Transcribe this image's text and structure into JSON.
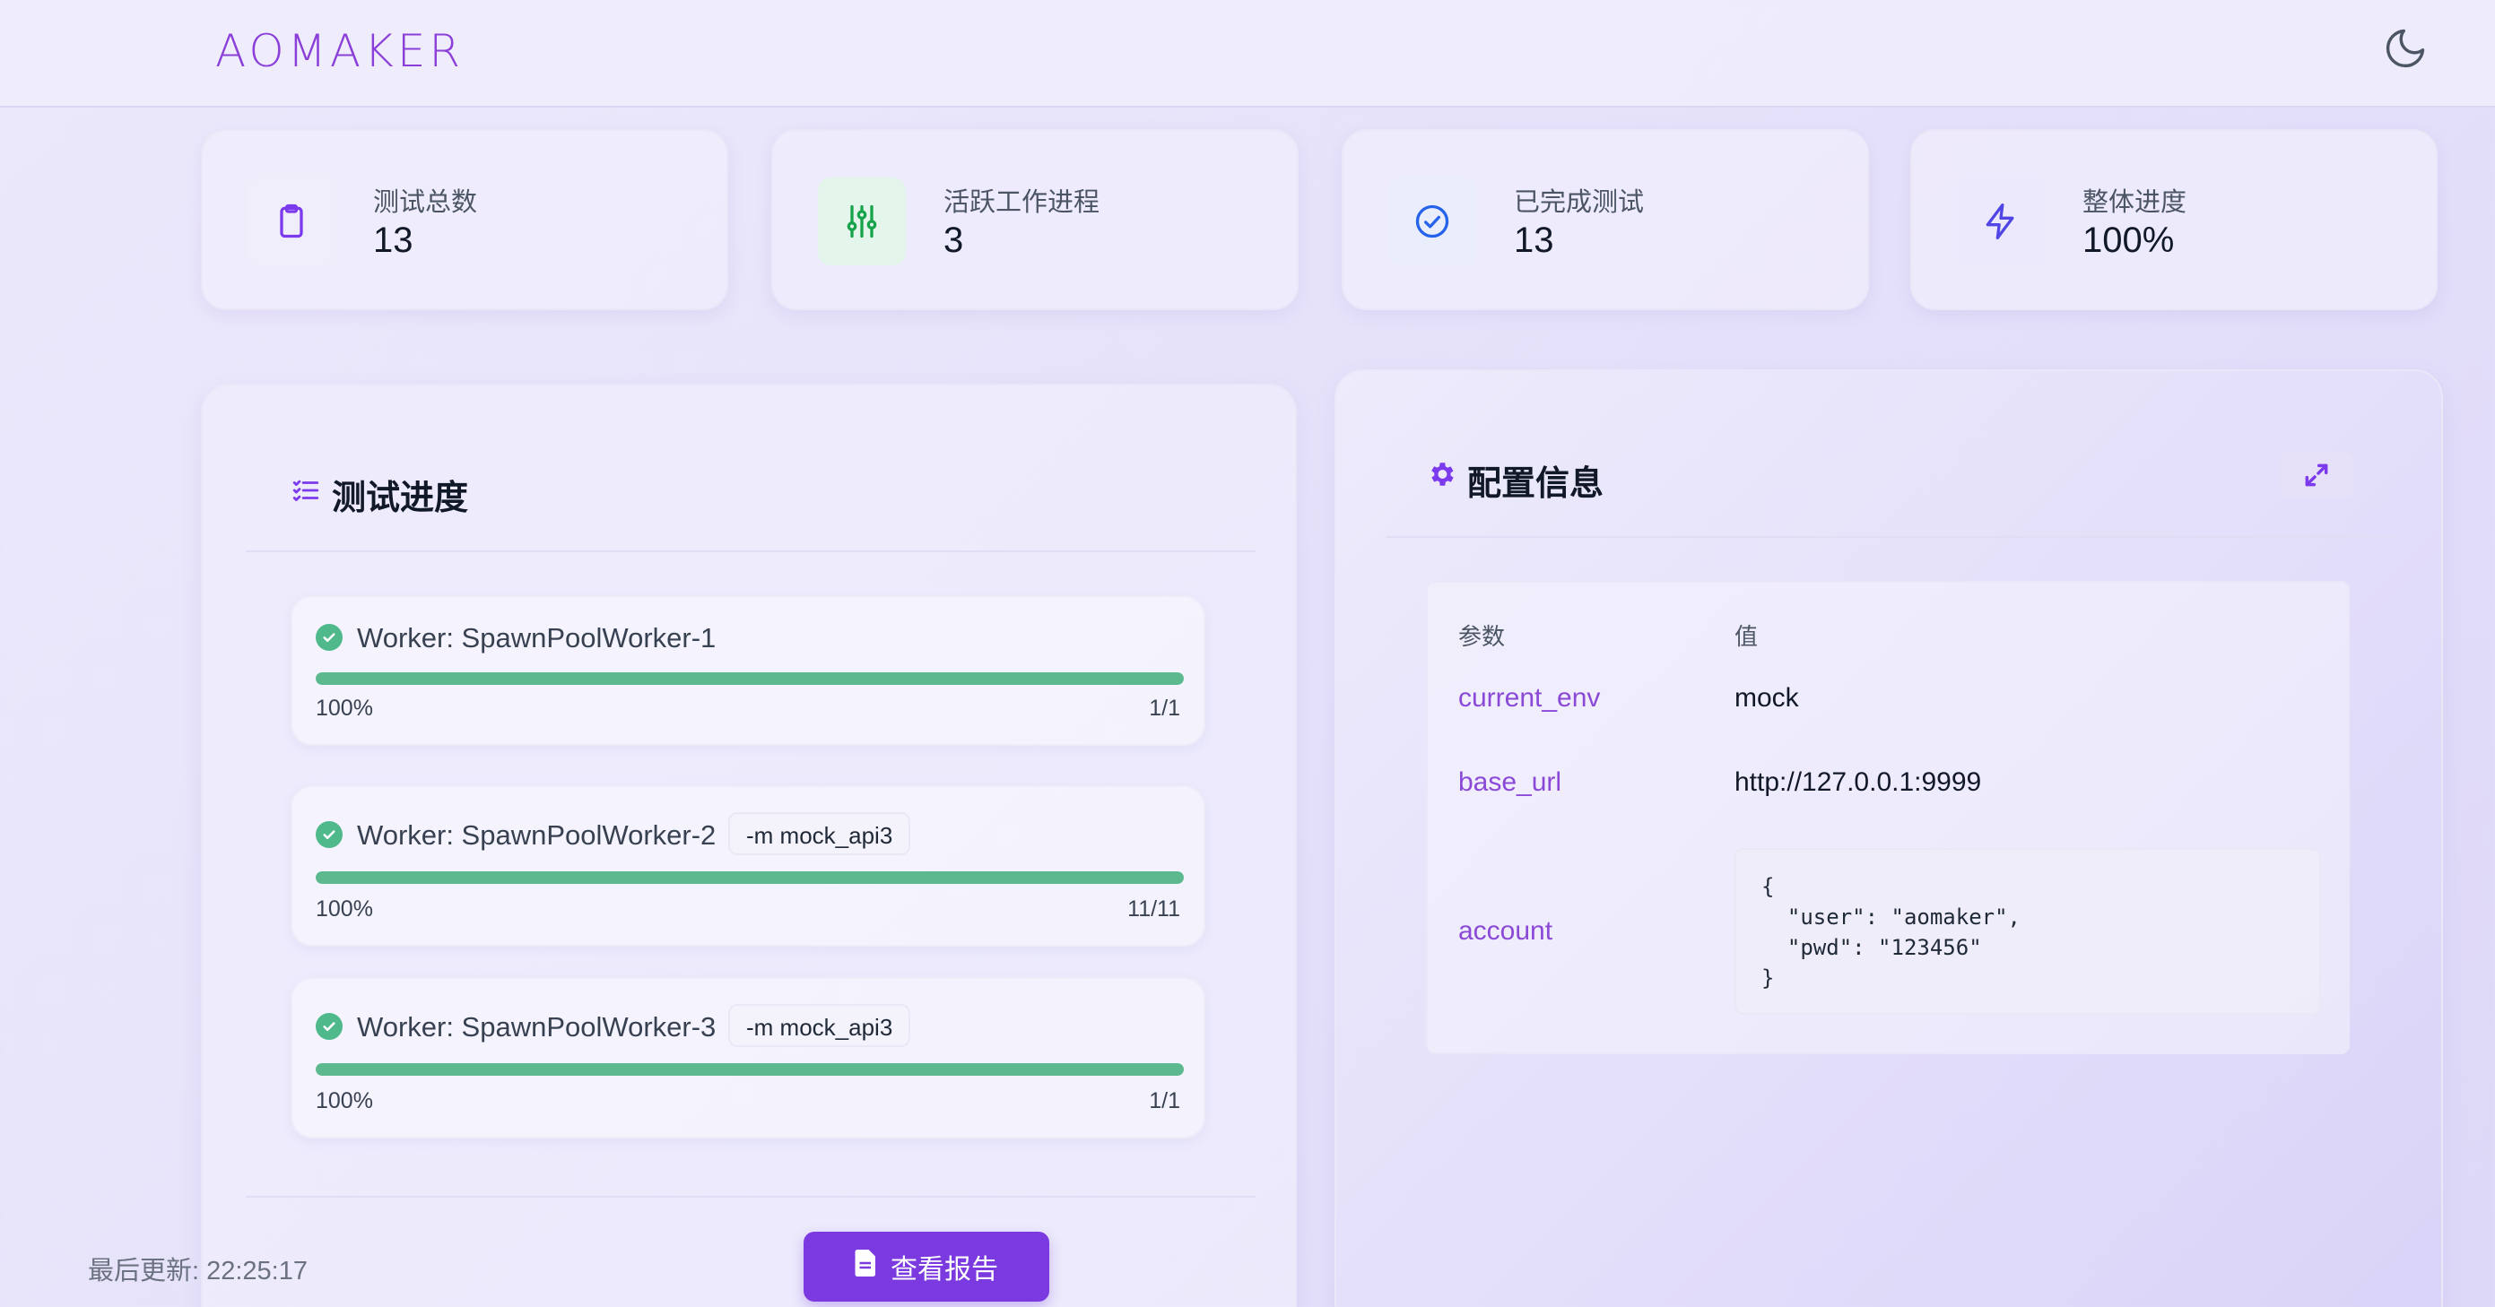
{
  "header": {
    "logo_text": "AOMAKER",
    "theme_toggle_icon": "moon-icon"
  },
  "stats": [
    {
      "label": "测试总数",
      "value": "13",
      "icon": "clipboard-icon",
      "color": "#7c3aed"
    },
    {
      "label": "活跃工作进程",
      "value": "3",
      "icon": "sliders-icon",
      "color": "#16a34a"
    },
    {
      "label": "已完成测试",
      "value": "13",
      "icon": "check-circle-icon",
      "color": "#2563eb"
    },
    {
      "label": "整体进度",
      "value": "100%",
      "icon": "lightning-icon",
      "color": "#4f46e5"
    }
  ],
  "progress_panel": {
    "title": "测试进度",
    "icon": "list-check-icon",
    "workers": [
      {
        "name": "Worker: SpawnPoolWorker-1",
        "tag": "",
        "percent": "100%",
        "count": "1/1",
        "progress": 1.0
      },
      {
        "name": "Worker: SpawnPoolWorker-2",
        "tag": "-m mock_api3",
        "percent": "100%",
        "count": "11/11",
        "progress": 1.0
      },
      {
        "name": "Worker: SpawnPoolWorker-3",
        "tag": "-m mock_api3",
        "percent": "100%",
        "count": "1/1",
        "progress": 1.0
      }
    ],
    "last_update": "最后更新: 22:25:17",
    "report_button": "查看报告"
  },
  "config_panel": {
    "title": "配置信息",
    "icon": "gear-icon",
    "expand_icon": "expand-icon",
    "col_param": "参数",
    "col_value": "值",
    "rows": [
      {
        "key": "current_env",
        "value": "mock"
      },
      {
        "key": "base_url",
        "value": "http://127.0.0.1:9999"
      },
      {
        "key": "account",
        "value": "{\n  \"user\": \"aomaker\",\n  \"pwd\": \"123456\"\n}"
      }
    ]
  },
  "colors": {
    "accent": "#7b3ae0",
    "success": "#5cb88f",
    "key_text": "#8a49d6"
  }
}
